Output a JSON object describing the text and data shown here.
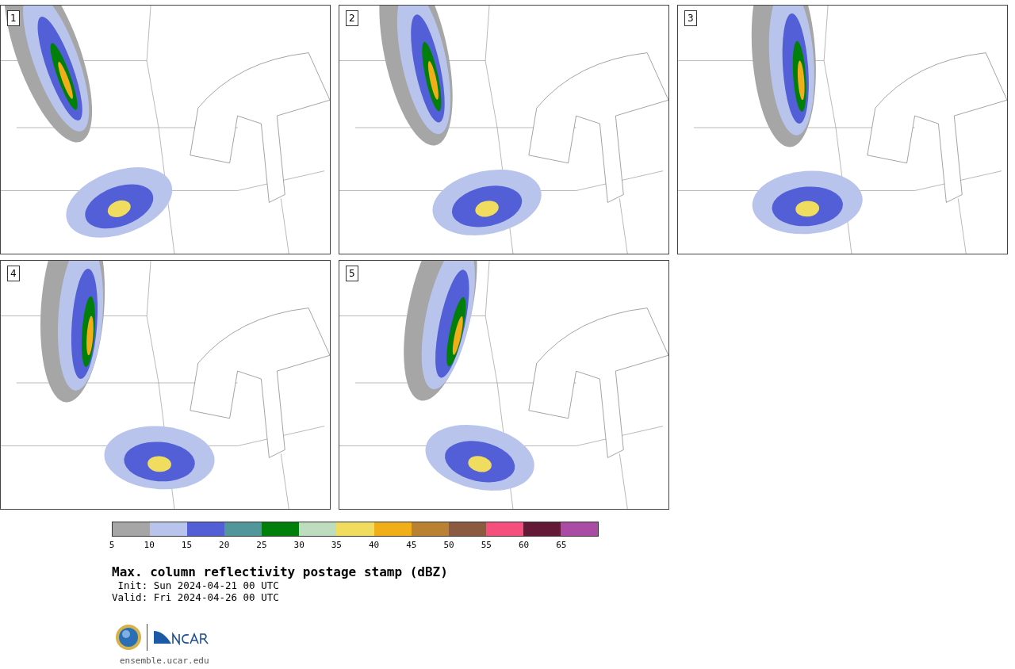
{
  "panels": [
    {
      "label": "1",
      "kind": "picture"
    },
    {
      "label": "2",
      "kind": "picture"
    },
    {
      "label": "3",
      "kind": "picture"
    },
    {
      "label": "4",
      "kind": "picture"
    },
    {
      "label": "5",
      "kind": "picture"
    }
  ],
  "colorbar": {
    "bins": [
      {
        "color": "#a6a6a6"
      },
      {
        "color": "#b8c4ec"
      },
      {
        "color": "#525fd6"
      },
      {
        "color": "#50969b"
      },
      {
        "color": "#00800a"
      },
      {
        "color": "#bedcbe"
      },
      {
        "color": "#f0dc5f"
      },
      {
        "color": "#f0af19"
      },
      {
        "color": "#b98232"
      },
      {
        "color": "#8c5a40"
      },
      {
        "color": "#f5507d"
      },
      {
        "color": "#641937"
      },
      {
        "color": "#aa4ba5"
      }
    ],
    "ticks": [
      "5",
      "10",
      "15",
      "20",
      "25",
      "30",
      "35",
      "40",
      "45",
      "50",
      "55",
      "60",
      "65"
    ]
  },
  "title": "Max. column reflectivity postage stamp (dBZ)",
  "init": " Init: Sun 2024-04-21 00 UTC",
  "valid": "Valid: Fri 2024-04-26 00 UTC",
  "footer_url": "ensemble.ucar.edu"
}
